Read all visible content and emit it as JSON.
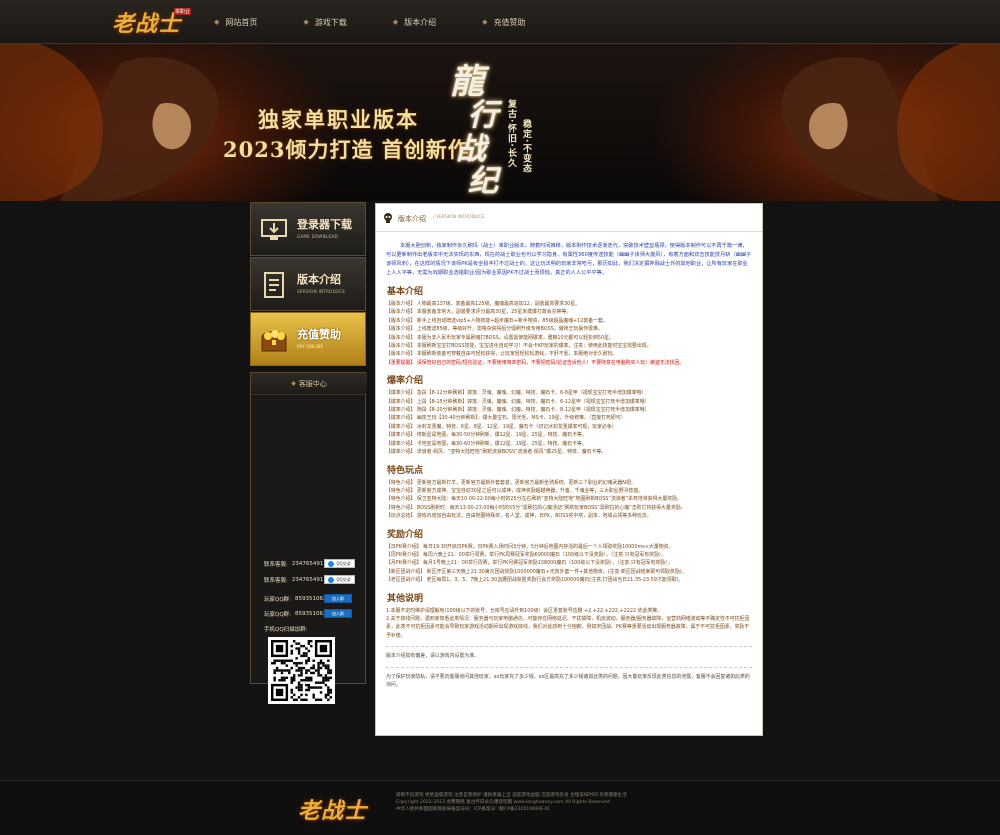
{
  "nav": {
    "logo_text": "老战士",
    "logo_badge": "单职业",
    "items": [
      {
        "label": "网站首页"
      },
      {
        "label": "游戏下载"
      },
      {
        "label": "版本介绍"
      },
      {
        "label": "充值赞助"
      }
    ]
  },
  "banner": {
    "line1": "独家单职业版本",
    "line2": "2023倾力打造 首创新作",
    "calli_chars": [
      "龍",
      "行",
      "战",
      "纪"
    ],
    "sub_cols": [
      "复古·怀旧·长久",
      "稳定·不变态"
    ]
  },
  "sidebar": {
    "download": {
      "label": "登录器下载",
      "sub": "GAME DOWNLOAD"
    },
    "version": {
      "label": "版本介绍",
      "sub": "VERSION INTRODUCE"
    },
    "pay": {
      "label": "充值赞助",
      "sub": "PAY ONLINE"
    },
    "service": {
      "title": "客服中心",
      "contacts": [
        {
          "label": "联系客服:",
          "value": "234765491",
          "btn": "QQ交谈"
        },
        {
          "label": "联系客服:",
          "value": "234765491",
          "btn": "QQ交谈"
        }
      ],
      "groups": [
        {
          "label": "玩家QQ群:",
          "value": "859351062",
          "btn": "加入群"
        },
        {
          "label": "玩家QQ群:",
          "value": "859351062",
          "btn": "加入群"
        }
      ],
      "qr_label": "手机QQ扫描加群:"
    }
  },
  "main": {
    "header_title": "版本介绍",
    "header_sub": "/ VERSION INTRODUCE",
    "intro": "本服大胆创新，独家制作永久刷玛（战士）单职业版本，随着时间推移，版本制作技术逐渐迭代，突破技术壁垒瓶颈，使得版本制作可以不再千篇一律，可以更新制作出老版本中无法实现的东西，现在的战士职业也可以学习隐身、有属性360度传送技能（幽幽子该师大旋风），有着方面和双击技能技月斩（幽幽子该师风刺），在这样的情况下该师PK是有全极丰打不过战士的，这让玩法明的玩家非常吃亏，那历如此，我们决定摒弃融战士外的其他职业，让所有玩家在职业上人人平等，无需为戏期职业选错职业/因为职业原因PK不过战士而烦恼，真正的人人公平平等。",
    "sections": [
      {
        "title": "基本介绍",
        "lines": [
          {
            "text": "【版本介绍】 人物最高137级，装备最高125级，魔魂最高追加12，副装最高要求30星。",
            "red": false
          },
          {
            "text": "【版本介绍】 本服装备非常大，副装要求评分最高30星，25星未摸爆打敢会兑换等。",
            "red": false
          },
          {
            "text": "【版本介绍】 新手上线自动赠送vip5+人物技能+超步魔石+新手物资，85级超晶魔魂+12装备一套。",
            "red": false
          },
          {
            "text": "【版本介绍】 上线赠送85级，等级好升，需格杂获得后分馏刷升级专用BOSS，傲娇王玩操作很难。",
            "red": false
          },
          {
            "text": "【版本介绍】 本服为非人民币玩家专属刷魂打BOSS，设置副使能网爆率，雅娘10元都可以轻松到50星。",
            "red": false
          },
          {
            "text": "【版本介绍】 本服刷新宝宝打BOSS技能，宝宝进化自动学习！不会卡KP玩家的爆率，注意：使用此技能时宝宝需要出现。",
            "red": false
          },
          {
            "text": "【版本介绍】 本服刷新装备可穿戴自由可轻松获得，让玩家轻轻松松游戏，不肝不氪，本服绝对长久耐玩。",
            "red": false
          },
          {
            "text": "【重要提醒】 请保管好自己的密码/短信验证，不要使用简单密码，不要把密码/验证告诉他人！不要随意在电脑购买人玩）被盗无法找回。",
            "red": true
          }
        ]
      },
      {
        "title": "爆率介绍",
        "lines": [
          {
            "text": "【爆率介绍】 急段【8-12分钟刷新】掉落：灵魂、魔魂、幻魔、特技、魔石卡、6-8星甲（视现宝宝打死半增加爆率哦）",
            "red": false
          },
          {
            "text": "【爆率介绍】 上段【8-15分钟刷新】掉落：灵魂、魔魂、幻魔、特技、魔石卡、6-12星甲（视现宝宝打死半增加爆率哦）",
            "red": false
          },
          {
            "text": "【爆率介绍】 随段【8-20分钟刷新】掉落：灵魂、魔魂、幻魔、特技、魔石卡、8-12星甲（视现宝宝打死半增加爆率哦）",
            "red": false
          },
          {
            "text": "【爆率介绍】 幽泉王玩【30-40分钟刷新】：爆大量宝石、阳光毛、MS卡、19星，升级修椎。（直接打死即可）",
            "red": false
          },
          {
            "text": "【爆率介绍】 冰封龙重魔、特技、6星、8星、12星、19星、魔石卡（切记冰封龙重爆率可观，玩家必争）",
            "red": false
          },
          {
            "text": "【爆率介绍】 修斯星是地图，每30-50分钟刷新，爆12星、19星、25星，特技、魔石卡等。",
            "red": false
          },
          {
            "text": "【爆率介绍】 卡地亚是地图，每30-60分钟刷新，爆12星、19星、25星，特技、魔石卡等。",
            "red": false
          },
          {
            "text": "【爆率介绍】 流浪者·佩风：“亚特大陆旺地”刷新流浪BOSS“流浪者·佩风”爆25星、特技、魔石卡等。",
            "red": false
          }
        ]
      },
      {
        "title": "特色玩点",
        "lines": [
          {
            "text": "【特色介绍】 更新官方最新打羊，更新官方最新外套套装，更新官方最新坐骑系统，更新三个职业的幻魂武器N把。",
            "red": false
          },
          {
            "text": "【特色介绍】 更新官方成神、宝宝自动30星之后可以成神，成神奖励超越神器，升备、千魂业等；三大职业野寻技能。",
            "red": false
          },
          {
            "text": "【特色介绍】 保卫亚特大陆：每天10:00-22:00每小时的25分左右刷新“亚特大陆旺地”地图刷新BOSS“流浪者”杀死地将获得大量奖励。",
            "red": false
          },
          {
            "text": "【特色介绍】 BOSS刷新时：每天13:00-23:00每小时的55分“需刷拉的心魔活动”刷新玩家BOSS“需刷拉的心魔”击败它将获得大量奖励。",
            "red": false
          },
          {
            "text": "【玩点总结】 游戏内增加自由玩法，自由地图特殊奖，名人堂，成神，日PK，BOSS奖中奖，副本，地域占领等多种玩法。",
            "red": false
          }
        ]
      },
      {
        "title": "奖励介绍",
        "lines": [
          {
            "text": "【日PK赛介绍】 每日19:30开启日PK赛，日PK赛入场时间3分钟，5分钟后地图内存活的最后一个人领取奖励10000ms+大量物资。",
            "red": false
          },
          {
            "text": "【周PK赛介绍】 每周六晚上21：00举行周赛，举行PK周赛冠军奖励69000魔石（100级以下没奖励），（注意:只有冠军有奖励）。",
            "red": false
          },
          {
            "text": "【月PK赛介绍】 每月1号晚上21：00举行周赛，举行PK月赛冠军奖励138000魔石（100级以下没奖励），（注意:只有冠军有奖励）。",
            "red": false
          },
          {
            "text": "【新区团战介绍】 新区开区第三天晚上21:30第次团战奖励1000000魔石+光效外套一件+其他物资。(注意:新区团战结束即可领取奖励)。",
            "red": false
          },
          {
            "text": "【老区团战介绍】 老区每周1、3、5、7晚上21:30血腰团战获胜奖励行会方奖励100000魔石(注意:打团战当日21:35-23:59才能领取)。",
            "red": false
          }
        ]
      }
    ],
    "other_title": "其他说明",
    "other_paras": [
      "1.本服不定时维护请理解哈(100级以下的账号，仓库号在请升到100级）会区重复账号估删 +2,+22,+222,+2222 依此类推。",
      "2.关于掉线问题，遇到家知悉此类情况：服务器与玩家电脑通信，可能存在网络延迟、干扰故障，机房波动，服务器/服务器故障，运营商网络波动等不确定性不可抗拒因素，此类不可抗拒因素可能会导致玩家游戏活动期间出现游戏掉线，我们对此感到十分抱歉，例如宋团战、PK赛等重要活动出现服务器故障，属于不可抗拒因素，奖励不予补偿。"
    ],
    "notes": [
      "版本介绍如有偏差，请以游戏内设置为准。",
      "为了保护玩家隐私，请不要向客服询问其他玩家，xx玩家充了多少钱，xx区最高充了多少钱诸如此类的问题，因大量玩家反馈此类信息的泄露，客服不会回复诸如此类的询问。"
    ]
  },
  "footer": {
    "logo_text": "老战士",
    "lines": [
      "抵制不良游戏 拒绝盗版游戏 注意自我保护 谨防受骗上当 适度游戏益脑 沉迷游戏伤身 合理安排时间 享受健康生活",
      "Copyright 2022-2023 龙腾网络 复古怀旧永久爆烧玩服 www.longhuanny.com All Rights Reserved",
      "中华人民共和国国家版权局备案号码：ICP备案号: 湘ICP备23051688号-01"
    ]
  }
}
